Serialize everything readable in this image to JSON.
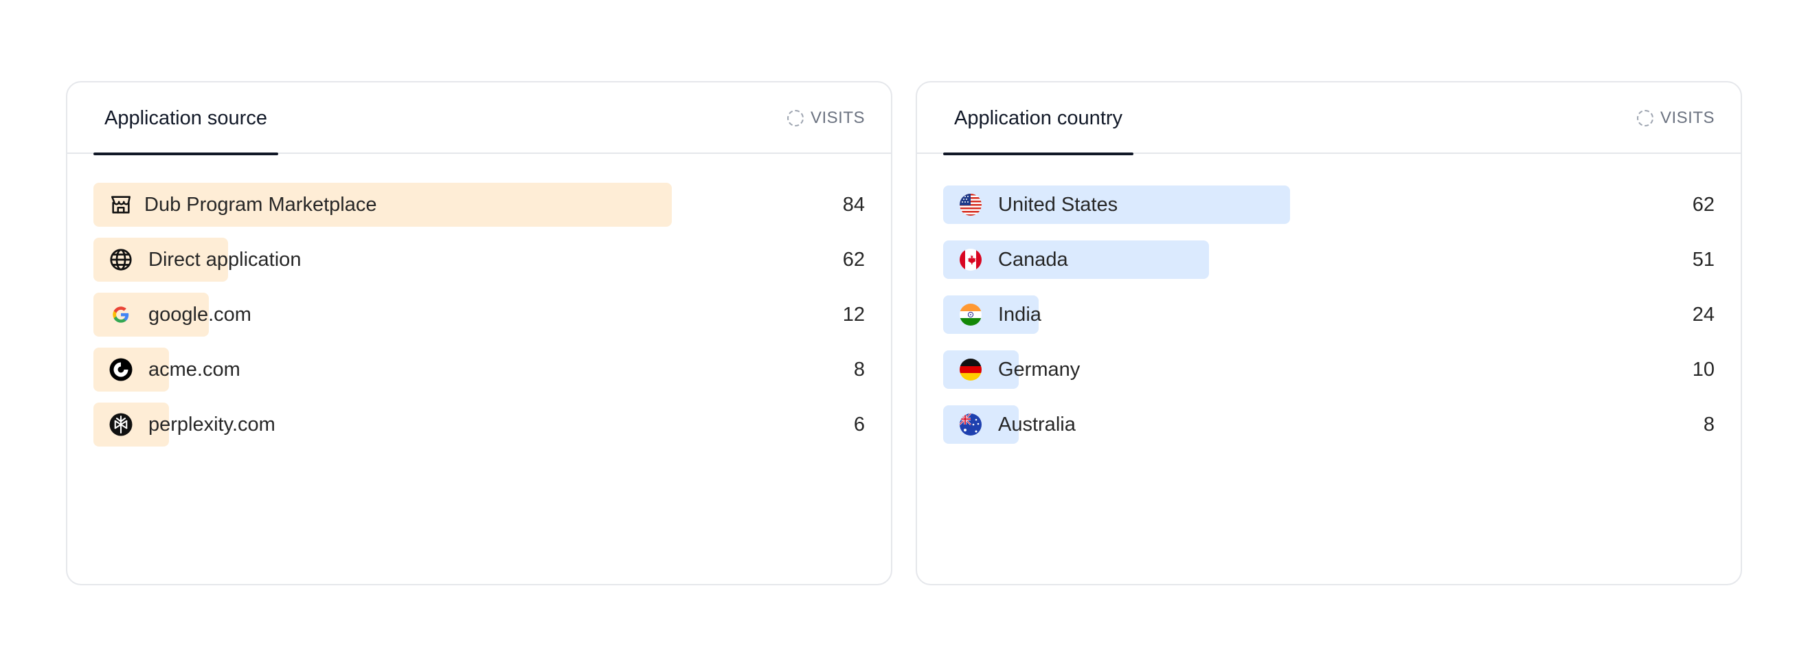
{
  "source_card": {
    "tab_label": "Application source",
    "metric_label": "VISITS",
    "items": [
      {
        "label": "Dub Program Marketplace",
        "value": "84",
        "icon": "storefront-icon",
        "fraction": 1.0
      },
      {
        "label": "Direct application",
        "value": "62",
        "icon": "globe-icon",
        "fraction": 0.233
      },
      {
        "label": "google.com",
        "value": "12",
        "icon": "google-icon",
        "fraction": 0.2
      },
      {
        "label": "acme.com",
        "value": "8",
        "icon": "acme-logo-icon",
        "fraction": 0.13
      },
      {
        "label": "perplexity.com",
        "value": "6",
        "icon": "perplexity-logo-icon",
        "fraction": 0.11
      }
    ]
  },
  "country_card": {
    "tab_label": "Application country",
    "metric_label": "VISITS",
    "items": [
      {
        "label": "United States",
        "value": "62",
        "icon": "us-flag-icon",
        "fraction": 0.6
      },
      {
        "label": "Canada",
        "value": "51",
        "icon": "canada-flag-icon",
        "fraction": 0.46
      },
      {
        "label": "India",
        "value": "24",
        "icon": "india-flag-icon",
        "fraction": 0.165
      },
      {
        "label": "Germany",
        "value": "10",
        "icon": "germany-flag-icon",
        "fraction": 0.108
      },
      {
        "label": "Australia",
        "value": "8",
        "icon": "australia-flag-icon",
        "fraction": 0.108
      }
    ]
  },
  "colors": {
    "source_bar": "#feedd6",
    "country_bar": "#dbeafe",
    "tab_underline": "#111827",
    "border": "#e5e7eb"
  }
}
